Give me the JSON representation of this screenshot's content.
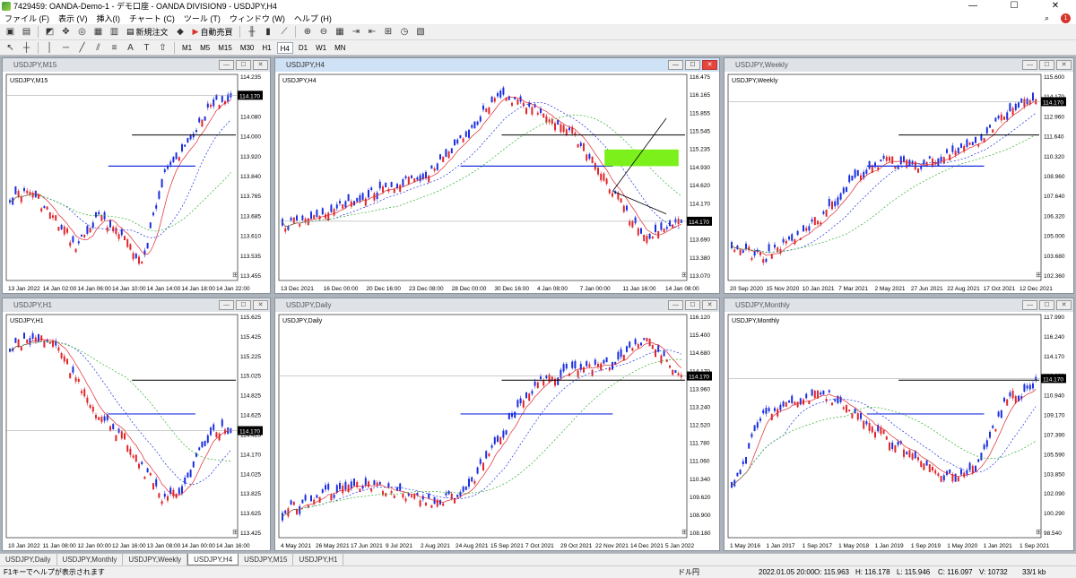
{
  "app": {
    "title": "7429459: OANDA-Demo-1 - デモ口座 - OANDA DIVISION9 - USDJPY,H4",
    "win_min": "—",
    "win_max": "☐",
    "win_close": "✕"
  },
  "menu": [
    "ファイル (F)",
    "表示 (V)",
    "挿入(I)",
    "チャート (C)",
    "ツール (T)",
    "ウィンドウ (W)",
    "ヘルプ (H)"
  ],
  "toolbar": {
    "new_order": "新規注文",
    "auto_trade": "自動売買"
  },
  "timeframes": [
    "M1",
    "M5",
    "M15",
    "M30",
    "H1",
    "H4",
    "D1",
    "W1",
    "MN"
  ],
  "active_timeframe": "H4",
  "notifications": "1",
  "charts": [
    {
      "title": "USDJPY,M15",
      "label": "USDJPY,M15",
      "price": "114.170",
      "yticks": [
        "114.235",
        "114.170",
        "114.080",
        "114.000",
        "113.920",
        "113.840",
        "113.765",
        "113.685",
        "113.610",
        "113.535",
        "113.455"
      ],
      "xticks": [
        "13 Jan 2022",
        "14 Jan 02:00",
        "14 Jan 06:00",
        "14 Jan 10:00",
        "14 Jan 14:00",
        "14 Jan 18:00",
        "14 Jan 22:00"
      ]
    },
    {
      "title": "USDJPY,H4",
      "label": "USDJPY,H4",
      "price": "114.170",
      "yticks": [
        "116.475",
        "116.165",
        "115.855",
        "115.545",
        "115.235",
        "114.930",
        "114.620",
        "114.170",
        "114.000",
        "113.690",
        "113.380",
        "113.070"
      ],
      "xticks": [
        "13 Dec 2021",
        "16 Dec 00:00",
        "20 Dec 16:00",
        "23 Dec 08:00",
        "28 Dec 00:00",
        "30 Dec 16:00",
        "4 Jan 08:00",
        "7 Jan 00:00",
        "11 Jan 16:00",
        "14 Jan 08:00"
      ]
    },
    {
      "title": "USDJPY,Weekly",
      "label": "USDJPY,Weekly",
      "price": "114.170",
      "yticks": [
        "115.600",
        "114.170",
        "112.960",
        "111.640",
        "110.320",
        "108.960",
        "107.640",
        "106.320",
        "105.000",
        "103.680",
        "102.360"
      ],
      "xticks": [
        "20 Sep 2020",
        "15 Nov 2020",
        "10 Jan 2021",
        "7 Mar 2021",
        "2 May 2021",
        "27 Jun 2021",
        "22 Aug 2021",
        "17 Oct 2021",
        "12 Dec 2021"
      ]
    },
    {
      "title": "USDJPY,H1",
      "label": "USDJPY,H1",
      "price": "114.170",
      "yticks": [
        "115.625",
        "115.425",
        "115.225",
        "115.025",
        "114.825",
        "114.625",
        "114.425",
        "114.170",
        "114.025",
        "113.825",
        "113.625",
        "113.425"
      ],
      "xticks": [
        "10 Jan 2022",
        "11 Jan 08:00",
        "12 Jan 00:00",
        "12 Jan 16:00",
        "13 Jan 08:00",
        "14 Jan 00:00",
        "14 Jan 16:00"
      ]
    },
    {
      "title": "USDJPY,Daily",
      "label": "USDJPY,Daily",
      "price": "114.170",
      "yticks": [
        "116.120",
        "115.400",
        "114.680",
        "114.170",
        "113.960",
        "113.240",
        "112.520",
        "111.780",
        "111.060",
        "110.340",
        "109.620",
        "108.900",
        "108.180"
      ],
      "xticks": [
        "4 May 2021",
        "26 May 2021",
        "17 Jun 2021",
        "9 Jul 2021",
        "2 Aug 2021",
        "24 Aug 2021",
        "15 Sep 2021",
        "7 Oct 2021",
        "29 Oct 2021",
        "22 Nov 2021",
        "14 Dec 2021",
        "5 Jan 2022"
      ]
    },
    {
      "title": "USDJPY,Monthly",
      "label": "USDJPY,Monthly",
      "price": "114.170",
      "yticks": [
        "117.990",
        "116.240",
        "114.170",
        "112.690",
        "110.940",
        "109.170",
        "107.390",
        "105.590",
        "103.850",
        "102.090",
        "100.290",
        "98.540"
      ],
      "xticks": [
        "1 May 2016",
        "1 Jan 2017",
        "1 Sep 2017",
        "1 May 2018",
        "1 Jan 2019",
        "1 Sep 2019",
        "1 May 2020",
        "1 Jan 2021",
        "1 Sep 2021"
      ]
    }
  ],
  "tabs": [
    "USDJPY,Daily",
    "USDJPY,Monthly",
    "USDJPY,Weekly",
    "USDJPY,H4",
    "USDJPY,M15",
    "USDJPY,H1"
  ],
  "active_tab": "USDJPY,H4",
  "status": {
    "help": "F1キーでヘルプが表示されます",
    "mode": "ドル円",
    "datetime": "2022.01.05 20:00",
    "open": "O: 115.963",
    "high": "H: 116.178",
    "low": "L: 115.946",
    "close": "C: 116.097",
    "volume": "V: 10732",
    "traffic": "33/1 kb"
  }
}
